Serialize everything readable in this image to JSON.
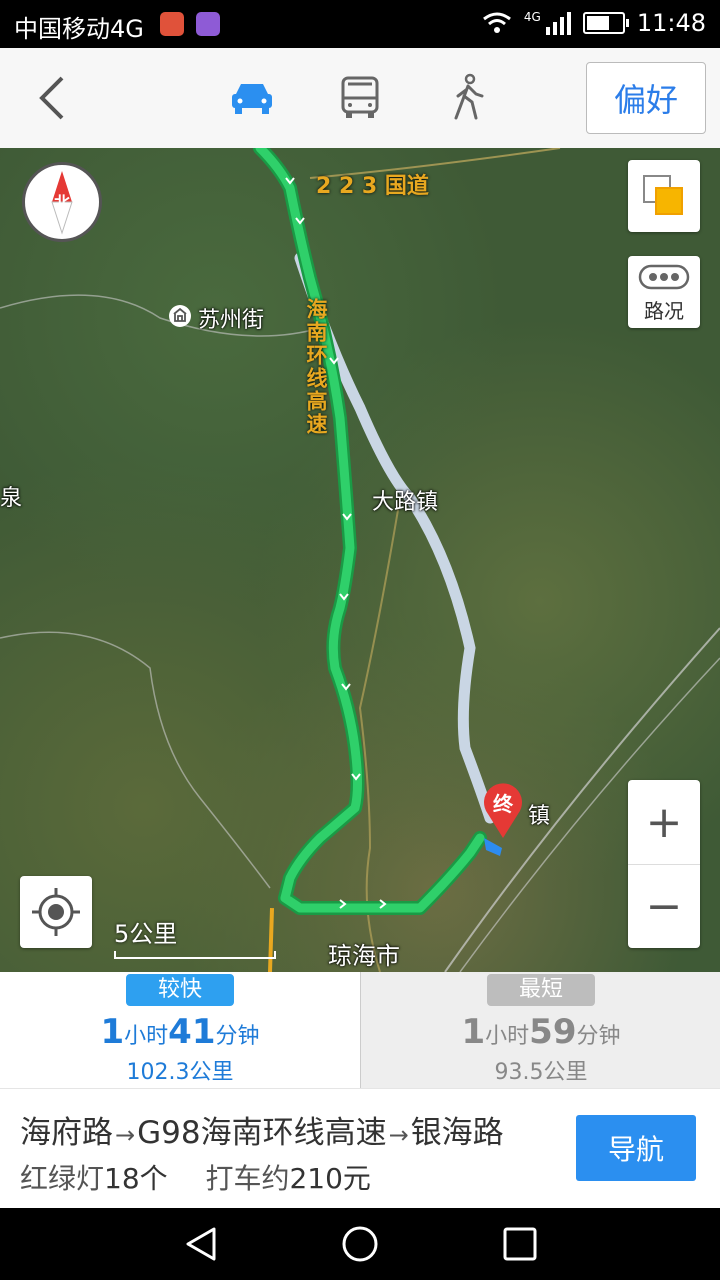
{
  "status": {
    "carrier": "中国移动4G",
    "net": "4G",
    "time": "11:48"
  },
  "header": {
    "preference": "偏好",
    "modes": [
      "car-icon",
      "bus-icon",
      "walk-icon"
    ]
  },
  "map": {
    "compass": "北",
    "traffic": "路况",
    "labels": {
      "road_223": "2 2 3 国道",
      "highway": "海南环线高速",
      "suzhou": "苏州街",
      "dalu": "大路镇",
      "quan": "泉",
      "town_end": "镇",
      "qionghai": "琼海市",
      "end_marker": "终"
    },
    "scale": "5公里",
    "zoom_in": "+",
    "zoom_out": "−"
  },
  "options": [
    {
      "tag": "较快",
      "h": "1",
      "h_unit": "小时",
      "m": "41",
      "m_unit": "分钟",
      "distance": "102.3公里"
    },
    {
      "tag": "最短",
      "h": "1",
      "h_unit": "小时",
      "m": "59",
      "m_unit": "分钟",
      "distance": "93.5公里"
    }
  ],
  "detail": {
    "road1": "海府路",
    "road2": "G98海南环线高速",
    "road3": "银海路",
    "arrow": "→",
    "lights_label": "红绿灯",
    "lights_value": "18个",
    "taxi_label": "打车约",
    "taxi_value": "210元",
    "navigate": "导航"
  },
  "colors": {
    "accent": "#2b8ff0",
    "route": "#22c25a",
    "alt_route": "#c9d6e4",
    "marker": "#e53935"
  }
}
